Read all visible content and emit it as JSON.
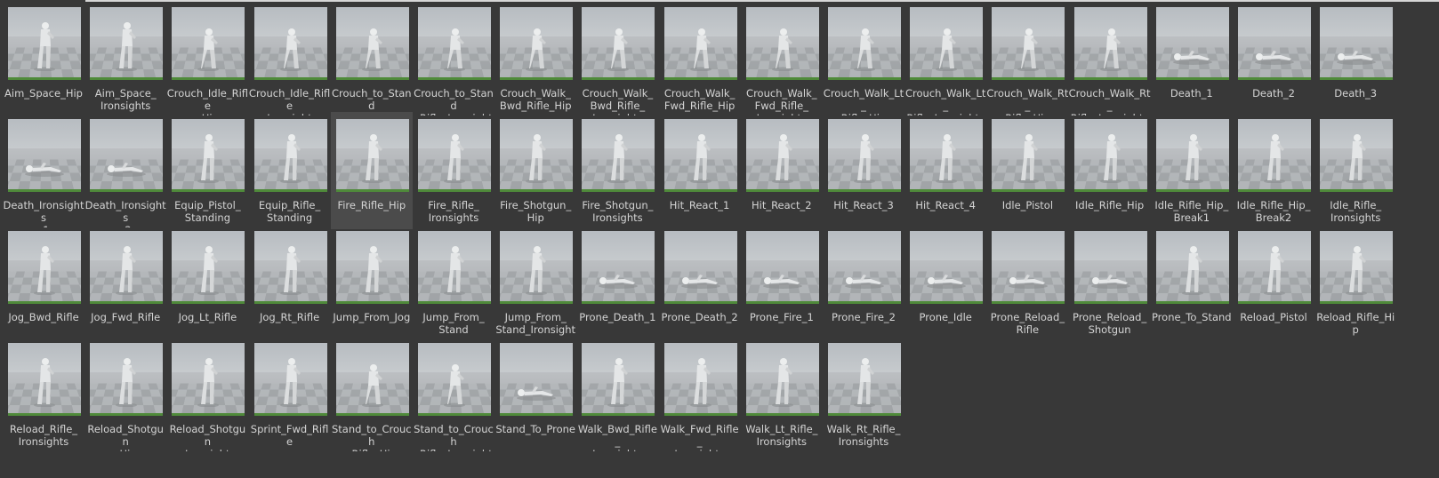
{
  "assets": [
    [
      "Aim_Space_Hip",
      "Aim_Space_\nIronsights",
      "Crouch_Idle_Rifle\n_Hip",
      "Crouch_Idle_Rifle\n_Ironsights",
      "Crouch_to_Stand\n_Rifle_Hip",
      "Crouch_to_Stand\n_Rifle_Ironsights",
      "Crouch_Walk_\nBwd_Rifle_Hip",
      "Crouch_Walk_\nBwd_Rifle_\nIronsights",
      "Crouch_Walk_\nFwd_Rifle_Hip",
      "Crouch_Walk_\nFwd_Rifle_\nIronsights",
      "Crouch_Walk_Lt_\nRifle_Hip",
      "Crouch_Walk_Lt_\nRifle_Ironsights",
      "Crouch_Walk_Rt_\nRifle_Hip",
      "Crouch_Walk_Rt_\nRifle_Ironsights",
      "Death_1",
      "Death_2",
      "Death_3"
    ],
    [
      "Death_Ironsights\n_1",
      "Death_Ironsights\n_2",
      "Equip_Pistol_\nStanding",
      "Equip_Rifle_\nStanding",
      "Fire_Rifle_Hip",
      "Fire_Rifle_\nIronsights",
      "Fire_Shotgun_\nHip",
      "Fire_Shotgun_\nIronsights",
      "Hit_React_1",
      "Hit_React_2",
      "Hit_React_3",
      "Hit_React_4",
      "Idle_Pistol",
      "Idle_Rifle_Hip",
      "Idle_Rifle_Hip_\nBreak1",
      "Idle_Rifle_Hip_\nBreak2",
      "Idle_Rifle_\nIronsights"
    ],
    [
      "Jog_Bwd_Rifle",
      "Jog_Fwd_Rifle",
      "Jog_Lt_Rifle",
      "Jog_Rt_Rifle",
      "Jump_From_Jog",
      "Jump_From_\nStand",
      "Jump_From_\nStand_Ironsights",
      "Prone_Death_1",
      "Prone_Death_2",
      "Prone_Fire_1",
      "Prone_Fire_2",
      "Prone_Idle",
      "Prone_Reload_\nRifle",
      "Prone_Reload_\nShotgun",
      "Prone_To_Stand",
      "Reload_Pistol",
      "Reload_Rifle_Hip"
    ],
    [
      "Reload_Rifle_\nIronsights",
      "Reload_Shotgun\n_Hip",
      "Reload_Shotgun\n_Ironsights",
      "Sprint_Fwd_Rifle",
      "Stand_to_Crouch\n_Rifle_Hip",
      "Stand_to_Crouch\n_Rifle_Ironsights",
      "Stand_To_Prone",
      "Walk_Bwd_Rifle_\nIronsights",
      "Walk_Fwd_Rifle_\nIronsights",
      "Walk_Lt_Rifle_\nIronsights",
      "Walk_Rt_Rifle_\nIronsights"
    ]
  ],
  "selected_asset": "Fire_Rifle_Hip",
  "colors": {
    "background": "#383838",
    "tile_selected": "#4b4b4b",
    "label_text": "#d4d4d4",
    "thumbnail_baseline": "#4f8a3a"
  }
}
